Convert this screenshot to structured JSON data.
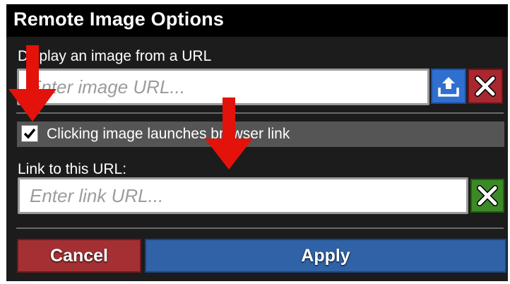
{
  "dialog": {
    "title": "Remote Image Options",
    "image_section": {
      "label": "Display an image from a URL",
      "url_value": "",
      "url_placeholder": "Enter image URL...",
      "upload_icon": "upload-icon",
      "clear_icon": "close-icon"
    },
    "link_checkbox": {
      "label": "Clicking image launches browser link",
      "checked": true
    },
    "link_section": {
      "label": "Link to this URL:",
      "url_value": "",
      "url_placeholder": "Enter link URL...",
      "clear_icon": "close-icon"
    },
    "buttons": {
      "cancel_label": "Cancel",
      "apply_label": "Apply"
    }
  },
  "colors": {
    "upload_button": "#2f6fd0",
    "clear_image_button": "#a9272f",
    "clear_link_button": "#3c8a25",
    "cancel_button": "#a43033",
    "apply_button": "#2f62a6",
    "annotation_arrow": "#e3120b"
  }
}
